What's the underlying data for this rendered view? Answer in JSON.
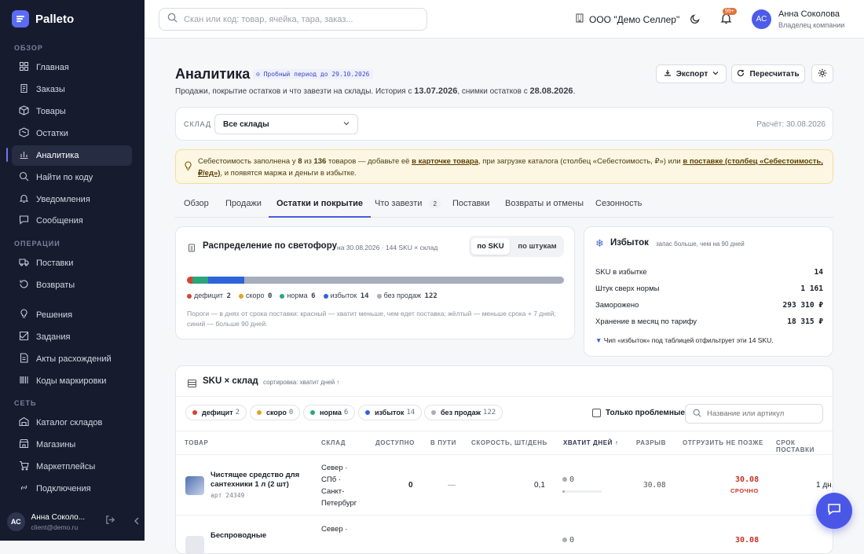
{
  "app": {
    "name": "Palleto",
    "logo_color": "#5b6cf3"
  },
  "sidebar": {
    "sections": {
      "overview": "ОБЗОР",
      "operations": "ОПЕРАЦИИ",
      "network": "СЕТЬ"
    },
    "items": [
      {
        "label": "Главная",
        "icon": "home-icon"
      },
      {
        "label": "Заказы",
        "icon": "orders-icon"
      },
      {
        "label": "Товары",
        "icon": "box-icon"
      },
      {
        "label": "Остатки",
        "icon": "stock-icon"
      },
      {
        "label": "Аналитика",
        "icon": "chart-icon",
        "active": true
      },
      {
        "label": "Найти по коду",
        "icon": "search-icon"
      },
      {
        "label": "Уведомления",
        "icon": "bell-icon"
      },
      {
        "label": "Сообщения",
        "icon": "message-icon"
      },
      {
        "label": "Поставки",
        "icon": "truck-icon"
      },
      {
        "label": "Возвраты",
        "icon": "return-icon"
      },
      {
        "label": "Решения",
        "icon": "bulb-icon"
      },
      {
        "label": "Задания",
        "icon": "task-icon"
      },
      {
        "label": "Акты расхождений",
        "icon": "doc-icon"
      },
      {
        "label": "Коды маркировки",
        "icon": "barcode-icon"
      },
      {
        "label": "Каталог складов",
        "icon": "warehouse-icon"
      },
      {
        "label": "Магазины",
        "icon": "store-icon"
      },
      {
        "label": "Маркетплейсы",
        "icon": "cart-icon"
      },
      {
        "label": "Подключения",
        "icon": "link-icon"
      }
    ],
    "user": {
      "initials": "АС",
      "name": "Анна Соколо...",
      "email": "client@demo.ru"
    }
  },
  "topbar": {
    "search_placeholder": "Скан или код: товар, ячейка, тара, заказ...",
    "org": "ООО \"Демо Селлер\"",
    "notif_badge": "99+",
    "user": {
      "initials": "АС",
      "name": "Анна Соколова",
      "role": "Владелец компании"
    }
  },
  "page": {
    "title": "Аналитика",
    "trial": "Пробный период до 29.10.2026",
    "subtitle_a": "Продажи, покрытие остатков и что завезти на склады. История с ",
    "history_date": "13.07.2026",
    "subtitle_b": ", снимки остатков с ",
    "snapshot_date": "28.08.2026",
    "subtitle_c": ".",
    "export_label": "Экспорт",
    "recalc_label": "Пересчитать"
  },
  "filter": {
    "label": "СКЛАД",
    "value": "Все склады",
    "calc": "Расчёт: 30.08.2026"
  },
  "notice": {
    "t1": "Себестоимость заполнена у ",
    "filled": "8",
    "t2": " из ",
    "total": "136",
    "t3": " товаров — добавьте её ",
    "link1": "в карточке товара",
    "t4": ", при загрузке каталога (столбец «Себестоимость, ₽») или ",
    "link2": "в поставке (столбец «Себестоимость, ₽/ед»)",
    "t5": ", и появятся маржа и деньги в избытке."
  },
  "tabs": [
    {
      "label": "Обзор"
    },
    {
      "label": "Продажи"
    },
    {
      "label": "Остатки и покрытие",
      "active": true
    },
    {
      "label": "Что завезти",
      "badge": "2"
    },
    {
      "label": "Поставки"
    },
    {
      "label": "Возвраты и отмены"
    },
    {
      "label": "Сезонность"
    }
  ],
  "traffic": {
    "title": "Распределение по светофору",
    "meta": "на 30.08.2026 · 144 SKU × склад",
    "toggle_a": "по SKU",
    "toggle_b": "по штукам",
    "segments": [
      {
        "name": "дефицит",
        "value": 2,
        "color": "#d6432f"
      },
      {
        "name": "скоро",
        "value": 0,
        "color": "#e0a326"
      },
      {
        "name": "норма",
        "value": 6,
        "color": "#2aa77a"
      },
      {
        "name": "избыток",
        "value": 14,
        "color": "#2f63d9"
      },
      {
        "name": "без продаж",
        "value": 122,
        "color": "#a7adba"
      }
    ],
    "hint": "Пороги — в днях от срока поставки: красный — хватит меньше, чем едет поставка; жёлтый — меньше срока + 7 дней; синий — больше 90 дней."
  },
  "excess": {
    "title": "Избыток",
    "meta": "запас больше, чем на 90 дней",
    "rows": [
      {
        "label": "SKU в избытке",
        "value": "14"
      },
      {
        "label": "Штук сверх нормы",
        "value": "1 161"
      },
      {
        "label": "Заморожено",
        "value": "293 310 ₽"
      },
      {
        "label": "Хранение в месяц по тарифу",
        "value": "18 315 ₽"
      }
    ],
    "footer": "Чип «избыток» под таблицей отфильтрует эти 14 SKU."
  },
  "sku_table": {
    "title": "SKU × склад",
    "sort": "сортировка: хватит дней ↑",
    "chips": [
      {
        "label": "дефицит",
        "count": "2",
        "color": "#d6432f"
      },
      {
        "label": "скоро",
        "count": "0",
        "color": "#e0a326"
      },
      {
        "label": "норма",
        "count": "6",
        "color": "#2aa77a"
      },
      {
        "label": "избыток",
        "count": "14",
        "color": "#2f63d9"
      },
      {
        "label": "без продаж",
        "count": "122",
        "color": "#a7adba"
      }
    ],
    "only_problem": "Только проблемные",
    "search_placeholder": "Название или артикул",
    "columns": [
      "ТОВАР",
      "СКЛАД",
      "ДОСТУПНО",
      "В ПУТИ",
      "СКОРОСТЬ, ШТ/ДЕНЬ",
      "ХВАТИТ ДНЕЙ ↑",
      "РАЗРЫВ",
      "ОТГРУЗИТЬ НЕ ПОЗЖЕ",
      "СРОК ПОСТАВКИ"
    ],
    "rows": [
      {
        "name": "Чистящее средство для сантехники 1 л (2 шт)",
        "art": "арт 24349",
        "warehouse": "Север · СПб · Санкт-Петербург",
        "available": "0",
        "in_transit": "—",
        "speed": "0,1",
        "days": "0",
        "gap": "30.08",
        "ship_by": "30.08",
        "urgent": "СРОЧНО",
        "lead": "1 дн."
      },
      {
        "name": "Беспроводные",
        "warehouse": "Север ·",
        "days": "0",
        "ship_by": "30.08"
      }
    ]
  }
}
